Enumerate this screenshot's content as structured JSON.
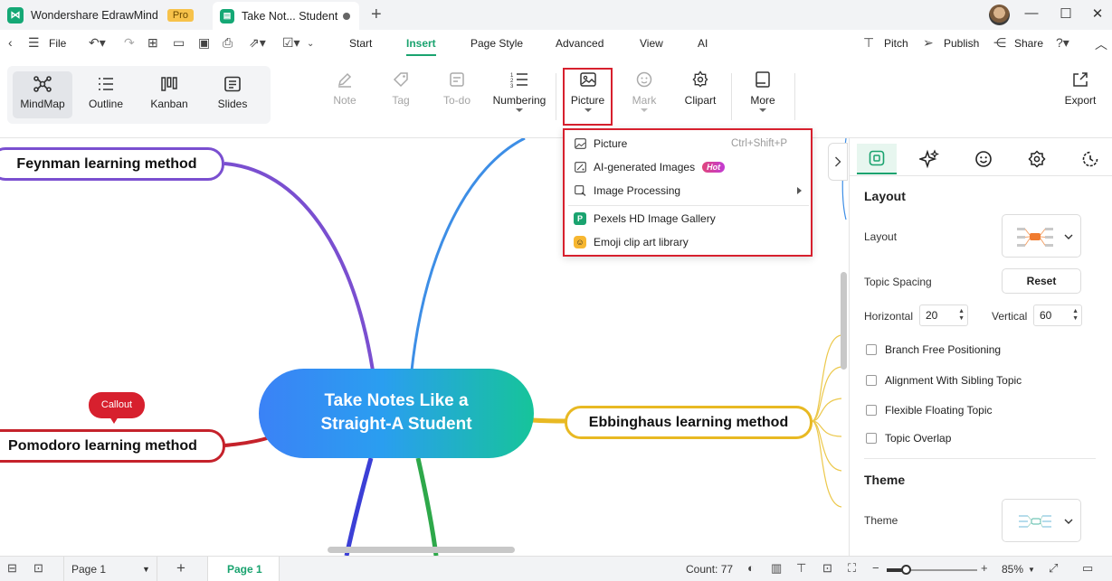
{
  "titlebar": {
    "app_name": "Wondershare EdrawMind",
    "pro_badge": "Pro",
    "doc_tab": "Take Not... Student",
    "new_tab_icon": "plus-icon",
    "window_controls": [
      "minimize-icon",
      "maximize-icon",
      "close-icon"
    ]
  },
  "menubar": {
    "file": "File",
    "items": [
      "Start",
      "Insert",
      "Page Style",
      "Advanced",
      "View",
      "AI"
    ],
    "active": "Insert",
    "right": {
      "pitch": "Pitch",
      "publish": "Publish",
      "share": "Share"
    }
  },
  "ribbon": {
    "views": [
      {
        "label": "MindMap",
        "icon": "mindmap-icon",
        "active": true
      },
      {
        "label": "Outline",
        "icon": "outline-icon",
        "active": false
      },
      {
        "label": "Kanban",
        "icon": "kanban-icon",
        "active": false
      },
      {
        "label": "Slides",
        "icon": "slides-icon",
        "active": false
      }
    ],
    "tools": {
      "note": "Note",
      "tag": "Tag",
      "todo": "To-do",
      "numbering": "Numbering",
      "picture": "Picture",
      "mark": "Mark",
      "clipart": "Clipart",
      "more": "More",
      "export": "Export"
    }
  },
  "picture_menu": {
    "items": [
      {
        "label": "Picture",
        "shortcut": "Ctrl+Shift+P",
        "icon": "image-icon"
      },
      {
        "label": "AI-generated Images",
        "badge": "Hot",
        "icon": "ai-image-icon"
      },
      {
        "label": "Image Processing",
        "submenu": true,
        "icon": "image-processing-icon"
      },
      {
        "label": "Pexels HD Image Gallery",
        "icon": "pexels-icon"
      },
      {
        "label": "Emoji clip art library",
        "icon": "emoji-icon"
      }
    ]
  },
  "mindmap": {
    "central": {
      "line1": "Take Notes Like a",
      "line2": "Straight-A Student"
    },
    "topics": {
      "feynman": "Feynman learning method",
      "pomodoro": "Pomodoro learning method",
      "ebbinghaus": "Ebbinghaus learning method"
    },
    "callout": "Callout",
    "colors": {
      "feynman": "#7a4fd0",
      "pomodoro": "#c5222b",
      "ebbinghaus": "#e8b923",
      "central_start": "#3b82f6",
      "central_end": "#16c49a"
    }
  },
  "panel": {
    "layout_heading": "Layout",
    "layout_label": "Layout",
    "topic_spacing_label": "Topic Spacing",
    "reset": "Reset",
    "horizontal_label": "Horizontal",
    "horizontal_value": "20",
    "vertical_label": "Vertical",
    "vertical_value": "60",
    "checkboxes": [
      "Branch Free Positioning",
      "Alignment With Sibling Topic",
      "Flexible Floating Topic",
      "Topic Overlap"
    ],
    "theme_heading": "Theme",
    "theme_label": "Theme"
  },
  "statusbar": {
    "page_select": "Page 1",
    "page_tab": "Page 1",
    "count": "Count: 77",
    "zoom": "85%"
  },
  "accent": "#1aa36f",
  "highlight": "#d7202e"
}
